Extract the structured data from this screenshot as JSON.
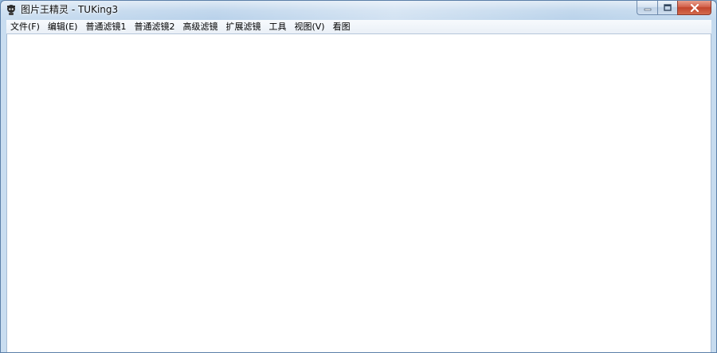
{
  "window": {
    "title": "图片王精灵 - TUKing3",
    "app_icon": "app-icon"
  },
  "caption_buttons": {
    "minimize_icon": "minimize-icon",
    "maximize_icon": "maximize-icon",
    "close_icon": "close-icon"
  },
  "menubar": {
    "items": [
      {
        "label": "文件(F)"
      },
      {
        "label": "编辑(E)"
      },
      {
        "label": "普通滤镜1"
      },
      {
        "label": "普通滤镜2"
      },
      {
        "label": "高级滤镜"
      },
      {
        "label": "扩展滤镜"
      },
      {
        "label": "工具"
      },
      {
        "label": "视图(V)"
      },
      {
        "label": "看图"
      }
    ]
  },
  "colors": {
    "client_background": "#ffffff",
    "titlebar": "#c9ddf0",
    "close_button": "#c2452c"
  }
}
